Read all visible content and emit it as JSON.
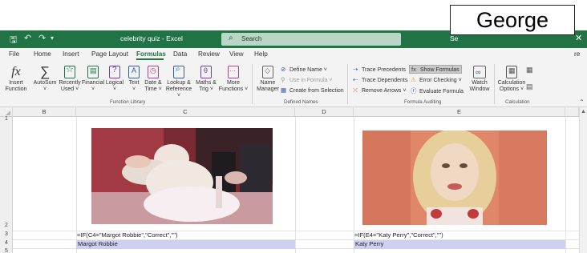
{
  "title_bar": {
    "save_icon": "save-icon",
    "title": "celebrity quiz - Excel",
    "search_placeholder": "Search",
    "user_partial": "Se",
    "close_glyph": "✕"
  },
  "name_overlay": "George",
  "menu": {
    "items": [
      "File",
      "Home",
      "Insert",
      "Page Layout",
      "Formulas",
      "Data",
      "Review",
      "View",
      "Help"
    ],
    "active": "Formulas",
    "right_partial": "re"
  },
  "ribbon": {
    "function_library": {
      "insert_function": [
        "Insert",
        "Function"
      ],
      "autosum": [
        "AutoSum",
        "˅"
      ],
      "recently_used": [
        "Recently",
        "Used ˅"
      ],
      "financial": [
        "Financial",
        "˅"
      ],
      "logical": [
        "Logical",
        "˅"
      ],
      "text": [
        "Text",
        "˅"
      ],
      "date_time": [
        "Date &",
        "Time ˅"
      ],
      "lookup_reference": [
        "Lookup &",
        "Reference ˅"
      ],
      "math_trig": [
        "Maths &",
        "Trig ˅"
      ],
      "more_functions": [
        "More",
        "Functions ˅"
      ],
      "group_label": "Function Library"
    },
    "defined_names": {
      "name_manager": [
        "Name",
        "Manager"
      ],
      "define_name": "Define Name ˅",
      "use_in_formula": "Use in Formula ˅",
      "create_from_selection": "Create from Selection",
      "group_label": "Defined Names"
    },
    "formula_auditing": {
      "trace_precedents": "Trace Precedents",
      "trace_dependents": "Trace Dependents",
      "remove_arrows": "Remove Arrows ˅",
      "show_formulas": "Show Formulas",
      "error_checking": "Error Checking ˅",
      "evaluate_formula": "Evaluate Formula",
      "watch_window": [
        "Watch",
        "Window"
      ],
      "group_label": "Formula Auditing"
    },
    "calculation": {
      "calculation_options": [
        "Calculation",
        "Options ˅"
      ],
      "group_label": "Calculation"
    }
  },
  "sheet": {
    "columns": [
      "B",
      "C",
      "D",
      "E"
    ],
    "rows": [
      "1",
      "2",
      "3",
      "4",
      "5"
    ],
    "cells": {
      "C3": "=IF(C4=\"Margot Robbie\",\"Correct\",\"\")",
      "C4": "Margot Robbie",
      "E3": "=IF(E4=\"Katy Perry\",\"Correct\",\"\")",
      "E4": "Katy Perry"
    },
    "highlight_color": "#cdd0f1"
  },
  "colors": {
    "excel_green": "#217346",
    "ribbon_bg": "#f3f3f3"
  }
}
